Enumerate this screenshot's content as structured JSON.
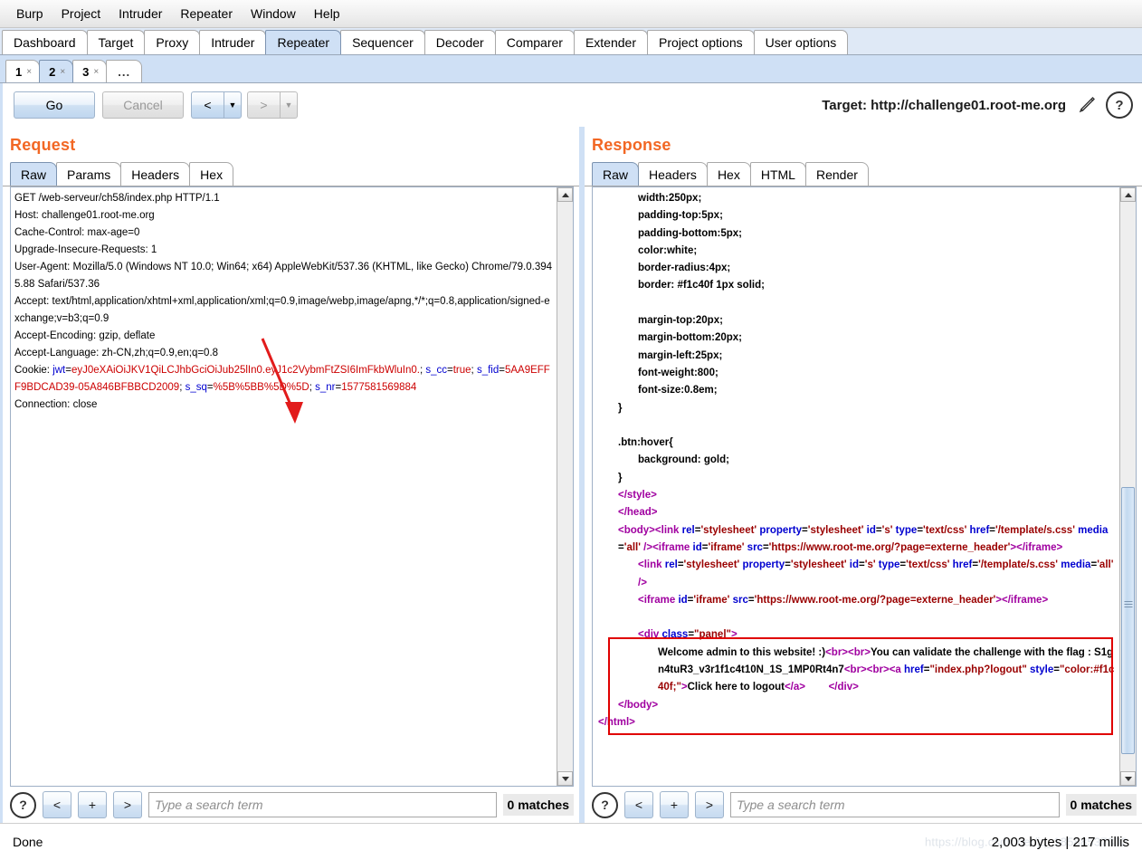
{
  "menubar": [
    "Burp",
    "Project",
    "Intruder",
    "Repeater",
    "Window",
    "Help"
  ],
  "main_tabs": [
    {
      "label": "Dashboard",
      "selected": false
    },
    {
      "label": "Target",
      "selected": false
    },
    {
      "label": "Proxy",
      "selected": false
    },
    {
      "label": "Intruder",
      "selected": false
    },
    {
      "label": "Repeater",
      "selected": true
    },
    {
      "label": "Sequencer",
      "selected": false
    },
    {
      "label": "Decoder",
      "selected": false
    },
    {
      "label": "Comparer",
      "selected": false
    },
    {
      "label": "Extender",
      "selected": false
    },
    {
      "label": "Project options",
      "selected": false
    },
    {
      "label": "User options",
      "selected": false
    }
  ],
  "repeater_tabs": [
    {
      "label": "1",
      "close": "×",
      "selected": false
    },
    {
      "label": "2",
      "close": "×",
      "selected": true
    },
    {
      "label": "3",
      "close": "×",
      "selected": false
    },
    {
      "label": "...",
      "close": "",
      "selected": false
    }
  ],
  "toolbar": {
    "go_label": "Go",
    "cancel_label": "Cancel",
    "back_label": "<",
    "back_dropdown": "▼",
    "forward_label": ">",
    "forward_dropdown": "▼",
    "target_label": "Target: http://challenge01.root-me.org",
    "edit_icon": "pencil-icon",
    "help_label": "?"
  },
  "request": {
    "title": "Request",
    "tabs": [
      {
        "label": "Raw",
        "selected": true
      },
      {
        "label": "Params",
        "selected": false
      },
      {
        "label": "Headers",
        "selected": false
      },
      {
        "label": "Hex",
        "selected": false
      }
    ],
    "lines": [
      [
        {
          "t": "GET /web-serveur/ch58/index.php HTTP/1.1",
          "c": "black"
        }
      ],
      [
        {
          "t": "Host: challenge01.root-me.org",
          "c": "black"
        }
      ],
      [
        {
          "t": "Cache-Control: max-age=0",
          "c": "black"
        }
      ],
      [
        {
          "t": "Upgrade-Insecure-Requests: 1",
          "c": "black"
        }
      ],
      [
        {
          "t": "User-Agent: Mozilla/5.0 (Windows NT 10.0; Win64; x64) AppleWebKit/537.36 (KHTML, like Gecko) Chrome/79.0.3945.88 Safari/537.36",
          "c": "black"
        }
      ],
      [
        {
          "t": "Accept: text/html,application/xhtml+xml,application/xml;q=0.9,image/webp,image/apng,*/*;q=0.8,application/signed-exchange;v=b3;q=0.9",
          "c": "black"
        }
      ],
      [
        {
          "t": "Accept-Encoding: gzip, deflate",
          "c": "black"
        }
      ],
      [
        {
          "t": "Accept-Language: zh-CN,zh;q=0.9,en;q=0.8",
          "c": "black"
        }
      ],
      [
        {
          "t": "Cookie: ",
          "c": "black"
        },
        {
          "t": "jwt",
          "c": "blue"
        },
        {
          "t": "=",
          "c": "black"
        },
        {
          "t": "eyJ0eXAiOiJKV1QiLCJhbGciOiJub25lIn0.eyJ1c2VybmFtZSI6ImFkbWluIn0.",
          "c": "red"
        },
        {
          "t": "; ",
          "c": "black"
        },
        {
          "t": "s_cc",
          "c": "blue"
        },
        {
          "t": "=",
          "c": "black"
        },
        {
          "t": "true",
          "c": "red"
        },
        {
          "t": "; ",
          "c": "black"
        },
        {
          "t": "s_fid",
          "c": "blue"
        },
        {
          "t": "=",
          "c": "black"
        },
        {
          "t": "5AA9EFFF9BDCAD39-05A846BFBBCD2009",
          "c": "red"
        },
        {
          "t": "; ",
          "c": "black"
        },
        {
          "t": "s_sq",
          "c": "blue"
        },
        {
          "t": "=",
          "c": "black"
        },
        {
          "t": "%5B%5BB%5D%5D",
          "c": "red"
        },
        {
          "t": "; ",
          "c": "black"
        },
        {
          "t": "s_nr",
          "c": "blue"
        },
        {
          "t": "=",
          "c": "black"
        },
        {
          "t": "1577581569884",
          "c": "red"
        }
      ],
      [
        {
          "t": "Connection: close",
          "c": "black"
        }
      ]
    ],
    "search": {
      "help_label": "?",
      "prev_label": "<",
      "add_label": "+",
      "next_label": ">",
      "placeholder": "Type a search term",
      "value": "",
      "matches": "0 matches"
    }
  },
  "response": {
    "title": "Response",
    "tabs": [
      {
        "label": "Raw",
        "selected": true
      },
      {
        "label": "Headers",
        "selected": false
      },
      {
        "label": "Hex",
        "selected": false
      },
      {
        "label": "HTML",
        "selected": false
      },
      {
        "label": "Render",
        "selected": false
      }
    ],
    "lines": [
      {
        "indent": 2,
        "parts": [
          {
            "t": "width:250px;",
            "c": "black"
          }
        ]
      },
      {
        "indent": 2,
        "parts": [
          {
            "t": "padding-top:5px;",
            "c": "black"
          }
        ]
      },
      {
        "indent": 2,
        "parts": [
          {
            "t": "padding-bottom:5px;",
            "c": "black"
          }
        ]
      },
      {
        "indent": 2,
        "parts": [
          {
            "t": "color:white;",
            "c": "black"
          }
        ]
      },
      {
        "indent": 2,
        "parts": [
          {
            "t": "border-radius:4px;",
            "c": "black"
          }
        ]
      },
      {
        "indent": 2,
        "parts": [
          {
            "t": "border: #f1c40f 1px solid;",
            "c": "black"
          }
        ]
      },
      {
        "indent": 2,
        "parts": [
          {
            "t": "",
            "c": "black"
          }
        ]
      },
      {
        "indent": 2,
        "parts": [
          {
            "t": "margin-top:20px;",
            "c": "black"
          }
        ]
      },
      {
        "indent": 2,
        "parts": [
          {
            "t": "margin-bottom:20px;",
            "c": "black"
          }
        ]
      },
      {
        "indent": 2,
        "parts": [
          {
            "t": "margin-left:25px;",
            "c": "black"
          }
        ]
      },
      {
        "indent": 2,
        "parts": [
          {
            "t": "font-weight:800;",
            "c": "black"
          }
        ]
      },
      {
        "indent": 2,
        "parts": [
          {
            "t": "font-size:0.8em;",
            "c": "black"
          }
        ]
      },
      {
        "indent": 1,
        "parts": [
          {
            "t": "}",
            "c": "black"
          }
        ]
      },
      {
        "indent": 1,
        "parts": [
          {
            "t": "",
            "c": "black"
          }
        ]
      },
      {
        "indent": 1,
        "parts": [
          {
            "t": ".btn:hover{",
            "c": "black"
          }
        ]
      },
      {
        "indent": 2,
        "parts": [
          {
            "t": "background: gold;",
            "c": "black"
          }
        ]
      },
      {
        "indent": 1,
        "parts": [
          {
            "t": "}",
            "c": "black"
          }
        ]
      },
      {
        "indent": 1,
        "parts": [
          {
            "t": "</style>",
            "c": "purple"
          }
        ]
      },
      {
        "indent": 1,
        "parts": [
          {
            "t": "</head>",
            "c": "purple"
          }
        ]
      },
      {
        "indent": 1,
        "parts": [
          {
            "t": "<body>",
            "c": "purple"
          },
          {
            "t": "<link ",
            "c": "purple"
          },
          {
            "t": "rel",
            "c": "blue"
          },
          {
            "t": "=",
            "c": "black"
          },
          {
            "t": "'stylesheet' ",
            "c": "dred"
          },
          {
            "t": "property",
            "c": "blue"
          },
          {
            "t": "=",
            "c": "black"
          },
          {
            "t": "'stylesheet' ",
            "c": "dred"
          },
          {
            "t": "id",
            "c": "blue"
          },
          {
            "t": "=",
            "c": "black"
          },
          {
            "t": "'s' ",
            "c": "dred"
          },
          {
            "t": "type",
            "c": "blue"
          },
          {
            "t": "=",
            "c": "black"
          },
          {
            "t": "'text/css' ",
            "c": "dred"
          },
          {
            "t": "href",
            "c": "blue"
          },
          {
            "t": "=",
            "c": "black"
          },
          {
            "t": "'/template/s.css' ",
            "c": "dred"
          },
          {
            "t": "media",
            "c": "blue"
          },
          {
            "t": "=",
            "c": "black"
          },
          {
            "t": "'all' ",
            "c": "dred"
          },
          {
            "t": "/>",
            "c": "purple"
          },
          {
            "t": "<iframe ",
            "c": "purple"
          },
          {
            "t": "id",
            "c": "blue"
          },
          {
            "t": "=",
            "c": "black"
          },
          {
            "t": "'iframe' ",
            "c": "dred"
          },
          {
            "t": "src",
            "c": "blue"
          },
          {
            "t": "=",
            "c": "black"
          },
          {
            "t": "'https://www.root-me.org/?page=externe_header'",
            "c": "dred"
          },
          {
            "t": ">",
            "c": "purple"
          },
          {
            "t": "</iframe>",
            "c": "purple"
          }
        ]
      },
      {
        "indent": 2,
        "parts": [
          {
            "t": "<link ",
            "c": "purple"
          },
          {
            "t": "rel",
            "c": "blue"
          },
          {
            "t": "=",
            "c": "black"
          },
          {
            "t": "'stylesheet' ",
            "c": "dred"
          },
          {
            "t": "property",
            "c": "blue"
          },
          {
            "t": "=",
            "c": "black"
          },
          {
            "t": "'stylesheet' ",
            "c": "dred"
          },
          {
            "t": "id",
            "c": "blue"
          },
          {
            "t": "=",
            "c": "black"
          },
          {
            "t": "'s' ",
            "c": "dred"
          },
          {
            "t": "type",
            "c": "blue"
          },
          {
            "t": "=",
            "c": "black"
          },
          {
            "t": "'text/css' ",
            "c": "dred"
          },
          {
            "t": "href",
            "c": "blue"
          },
          {
            "t": "=",
            "c": "black"
          },
          {
            "t": "'/template/s.css' ",
            "c": "dred"
          },
          {
            "t": "media",
            "c": "blue"
          },
          {
            "t": "=",
            "c": "black"
          },
          {
            "t": "'all' ",
            "c": "dred"
          },
          {
            "t": "/>",
            "c": "purple"
          }
        ]
      },
      {
        "indent": 2,
        "parts": [
          {
            "t": "<iframe ",
            "c": "purple"
          },
          {
            "t": "id",
            "c": "blue"
          },
          {
            "t": "=",
            "c": "black"
          },
          {
            "t": "'iframe' ",
            "c": "dred"
          },
          {
            "t": "src",
            "c": "blue"
          },
          {
            "t": "=",
            "c": "black"
          },
          {
            "t": "'https://www.root-me.org/?page=externe_header'",
            "c": "dred"
          },
          {
            "t": ">",
            "c": "purple"
          },
          {
            "t": "</iframe>",
            "c": "purple"
          }
        ]
      },
      {
        "indent": 2,
        "parts": [
          {
            "t": "",
            "c": "black"
          }
        ]
      },
      {
        "indent": 2,
        "parts": [
          {
            "t": "<div ",
            "c": "purple"
          },
          {
            "t": "class",
            "c": "blue"
          },
          {
            "t": "=",
            "c": "black"
          },
          {
            "t": "\"panel\"",
            "c": "dred"
          },
          {
            "t": ">",
            "c": "purple"
          }
        ]
      },
      {
        "indent": 3,
        "parts": [
          {
            "t": "Welcome admin to this website! :)",
            "c": "black"
          },
          {
            "t": "<br>",
            "c": "purple"
          },
          {
            "t": "<br>",
            "c": "purple"
          },
          {
            "t": "You can validate the challenge with the flag : S1gn4tuR3_v3r1f1c4t10N_1S_1MP0Rt4n7",
            "c": "black"
          },
          {
            "t": "<br>",
            "c": "purple"
          },
          {
            "t": "<br>",
            "c": "purple"
          },
          {
            "t": "<a ",
            "c": "purple"
          },
          {
            "t": "href",
            "c": "blue"
          },
          {
            "t": "=",
            "c": "black"
          },
          {
            "t": "\"index.php?logout\" ",
            "c": "dred"
          },
          {
            "t": "style",
            "c": "blue"
          },
          {
            "t": "=",
            "c": "black"
          },
          {
            "t": "\"color:#f1c40f;\"",
            "c": "dred"
          },
          {
            "t": ">",
            "c": "purple"
          },
          {
            "t": "Click here to logout",
            "c": "black"
          },
          {
            "t": "</a>",
            "c": "purple"
          },
          {
            "t": "        ",
            "c": "black"
          },
          {
            "t": "</div>",
            "c": "purple"
          }
        ]
      },
      {
        "indent": 1,
        "parts": [
          {
            "t": "</body>",
            "c": "purple"
          }
        ]
      },
      {
        "indent": 0,
        "parts": [
          {
            "t": "</html>",
            "c": "purple"
          }
        ]
      }
    ],
    "search": {
      "help_label": "?",
      "prev_label": "<",
      "add_label": "+",
      "next_label": ">",
      "placeholder": "Type a search term",
      "value": "",
      "matches": "0 matches"
    }
  },
  "statusbar": {
    "left": "Done",
    "right": "2,003 bytes | 217 millis",
    "watermark": "https://blog.csdn.net/jq_18588537302"
  },
  "colors": {
    "accent_orange": "#f26724",
    "tab_selected_blue": "#cfe0f5",
    "annotation_red": "#e00000",
    "syntax_blue": "#0000d0",
    "syntax_red": "#cc0000",
    "syntax_purple": "#a000a0"
  }
}
